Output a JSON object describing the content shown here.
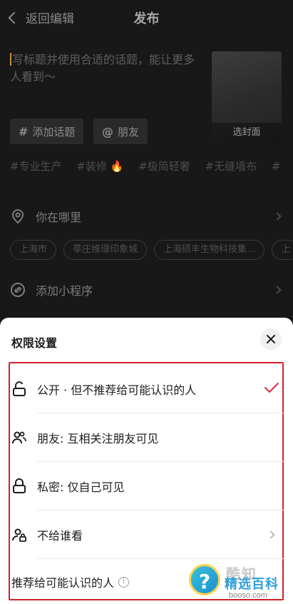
{
  "nav": {
    "back_label": "返回编辑",
    "title": "发布"
  },
  "caption": {
    "placeholder": "写标题并使用合适的话题，能让更多人看到～"
  },
  "cover": {
    "label": "选封面"
  },
  "chips": [
    {
      "symbol": "#",
      "label": "添加话题"
    },
    {
      "symbol": "@",
      "label": "朋友"
    }
  ],
  "hashtags": [
    "#专业生产",
    "#装修 🔥",
    "#极简轻奢",
    "#无缝墙布",
    "#"
  ],
  "location": {
    "label": "你在哪里",
    "places": [
      "上海市",
      "莘庄维璟印象城",
      "上海硕丰生物科技集...",
      "上"
    ]
  },
  "mini_program": {
    "label": "添加小程序"
  },
  "sheet": {
    "title": "权限设置",
    "options": [
      {
        "label": "公开 · 但不推荐给可能认识的人",
        "selected": true,
        "icon": "unlock-icon"
      },
      {
        "label": "朋友: 互相关注朋友可见",
        "selected": false,
        "icon": "friends-icon"
      },
      {
        "label": "私密: 仅自己可见",
        "selected": false,
        "icon": "lock-icon"
      },
      {
        "label": "不给谁看",
        "selected": false,
        "icon": "user-block-icon"
      }
    ],
    "recommend_label": "推荐给可能认识的人",
    "accent_check": "#e0344a"
  },
  "watermark": {
    "name": "酷知",
    "sub": "精选百科",
    "url": "booso.com",
    "symbol": "?"
  }
}
